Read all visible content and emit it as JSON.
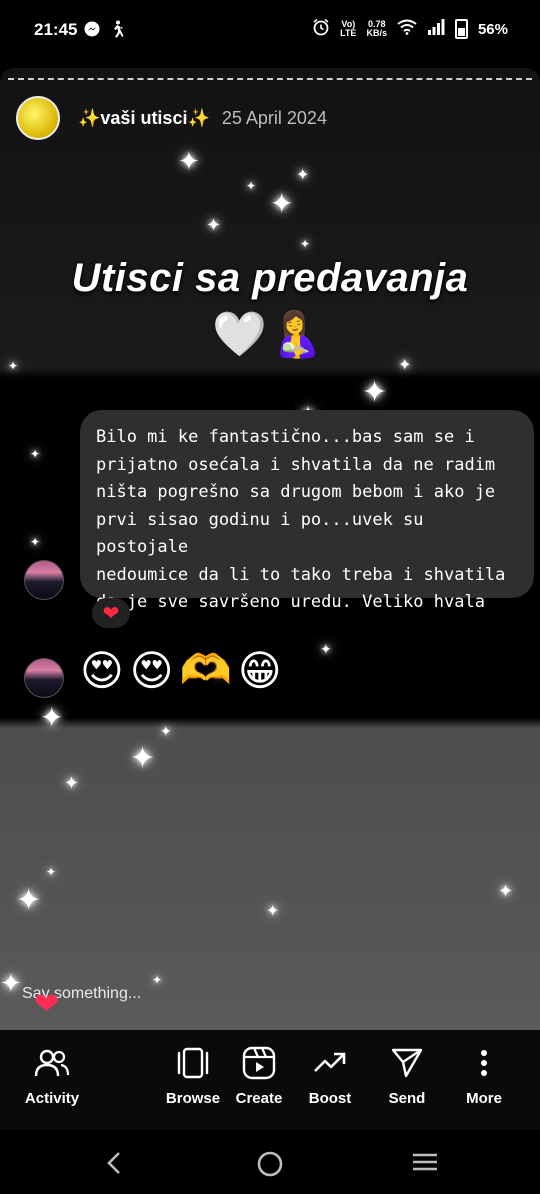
{
  "status_bar": {
    "time": "21:45",
    "net_speed_top": "0.78",
    "net_speed_bottom": "KB/s",
    "volte_top": "Vo)",
    "volte_bottom": "LTE",
    "battery": "56%",
    "icons": [
      "messenger-icon",
      "walking-icon",
      "alarm-icon",
      "wifi-icon",
      "signal-icon",
      "battery-icon"
    ]
  },
  "story": {
    "account_name": "✨vaši utisci✨",
    "date": "25 April 2024",
    "title": "Utisci sa predavanja",
    "title_emojis": [
      "🤍",
      "🤱"
    ],
    "message": {
      "lines": [
        "Bilo mi ke fantastično...bas sam se i",
        "prijatno osećala i shvatila da ne radim",
        "ništa pogrešno sa drugom bebom i ako je",
        "prvi sisao godinu i po...uvek su postojale",
        "nedoumice da li to tako treba i shvatila",
        "da je sve savršeno uredu. Veliko hvala"
      ],
      "reaction": "❤"
    },
    "emoji_reply": [
      "😍",
      "😍",
      "🫶",
      "😁"
    ],
    "reply_placeholder": "Say something..."
  },
  "bottom_bar": {
    "items": [
      {
        "label": "Activity",
        "icon": "people-icon"
      },
      {
        "label": "Browse",
        "icon": "browse-icon"
      },
      {
        "label": "Create",
        "icon": "reel-create-icon"
      },
      {
        "label": "Boost",
        "icon": "trending-up-icon"
      },
      {
        "label": "Send",
        "icon": "send-icon"
      },
      {
        "label": "More",
        "icon": "more-vertical-icon"
      }
    ]
  },
  "nav_bar": {
    "icons": [
      "back-icon",
      "home-icon",
      "recents-icon"
    ]
  }
}
